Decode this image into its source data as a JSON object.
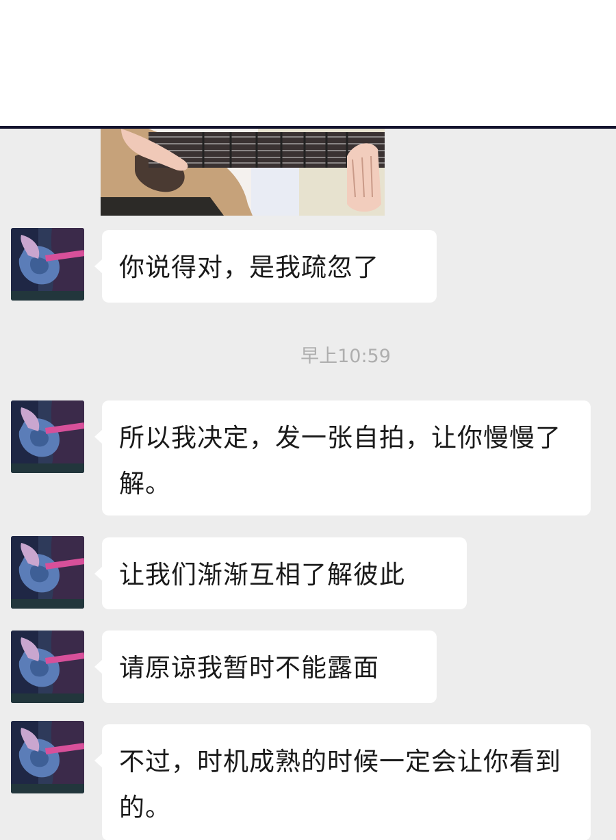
{
  "chat": {
    "timestamp": "早上10:59",
    "messages": [
      {
        "text": "你说得对，是我疏忽了"
      },
      {
        "text": "所以我决定，发一张自拍，让你慢慢了解。"
      },
      {
        "text": "让我们渐渐互相了解彼此"
      },
      {
        "text": "请原谅我暂时不能露面"
      },
      {
        "text": "不过，时机成熟的时候一定会让你看到的。"
      }
    ]
  },
  "colors": {
    "chat_background": "#ededed",
    "bubble": "#ffffff",
    "text": "#1a1a1a",
    "timestamp": "#aeaeae",
    "divider": "#14142e"
  },
  "icons": {
    "avatar": "guitar-avatar-icon",
    "photo": "guitar-photo"
  }
}
